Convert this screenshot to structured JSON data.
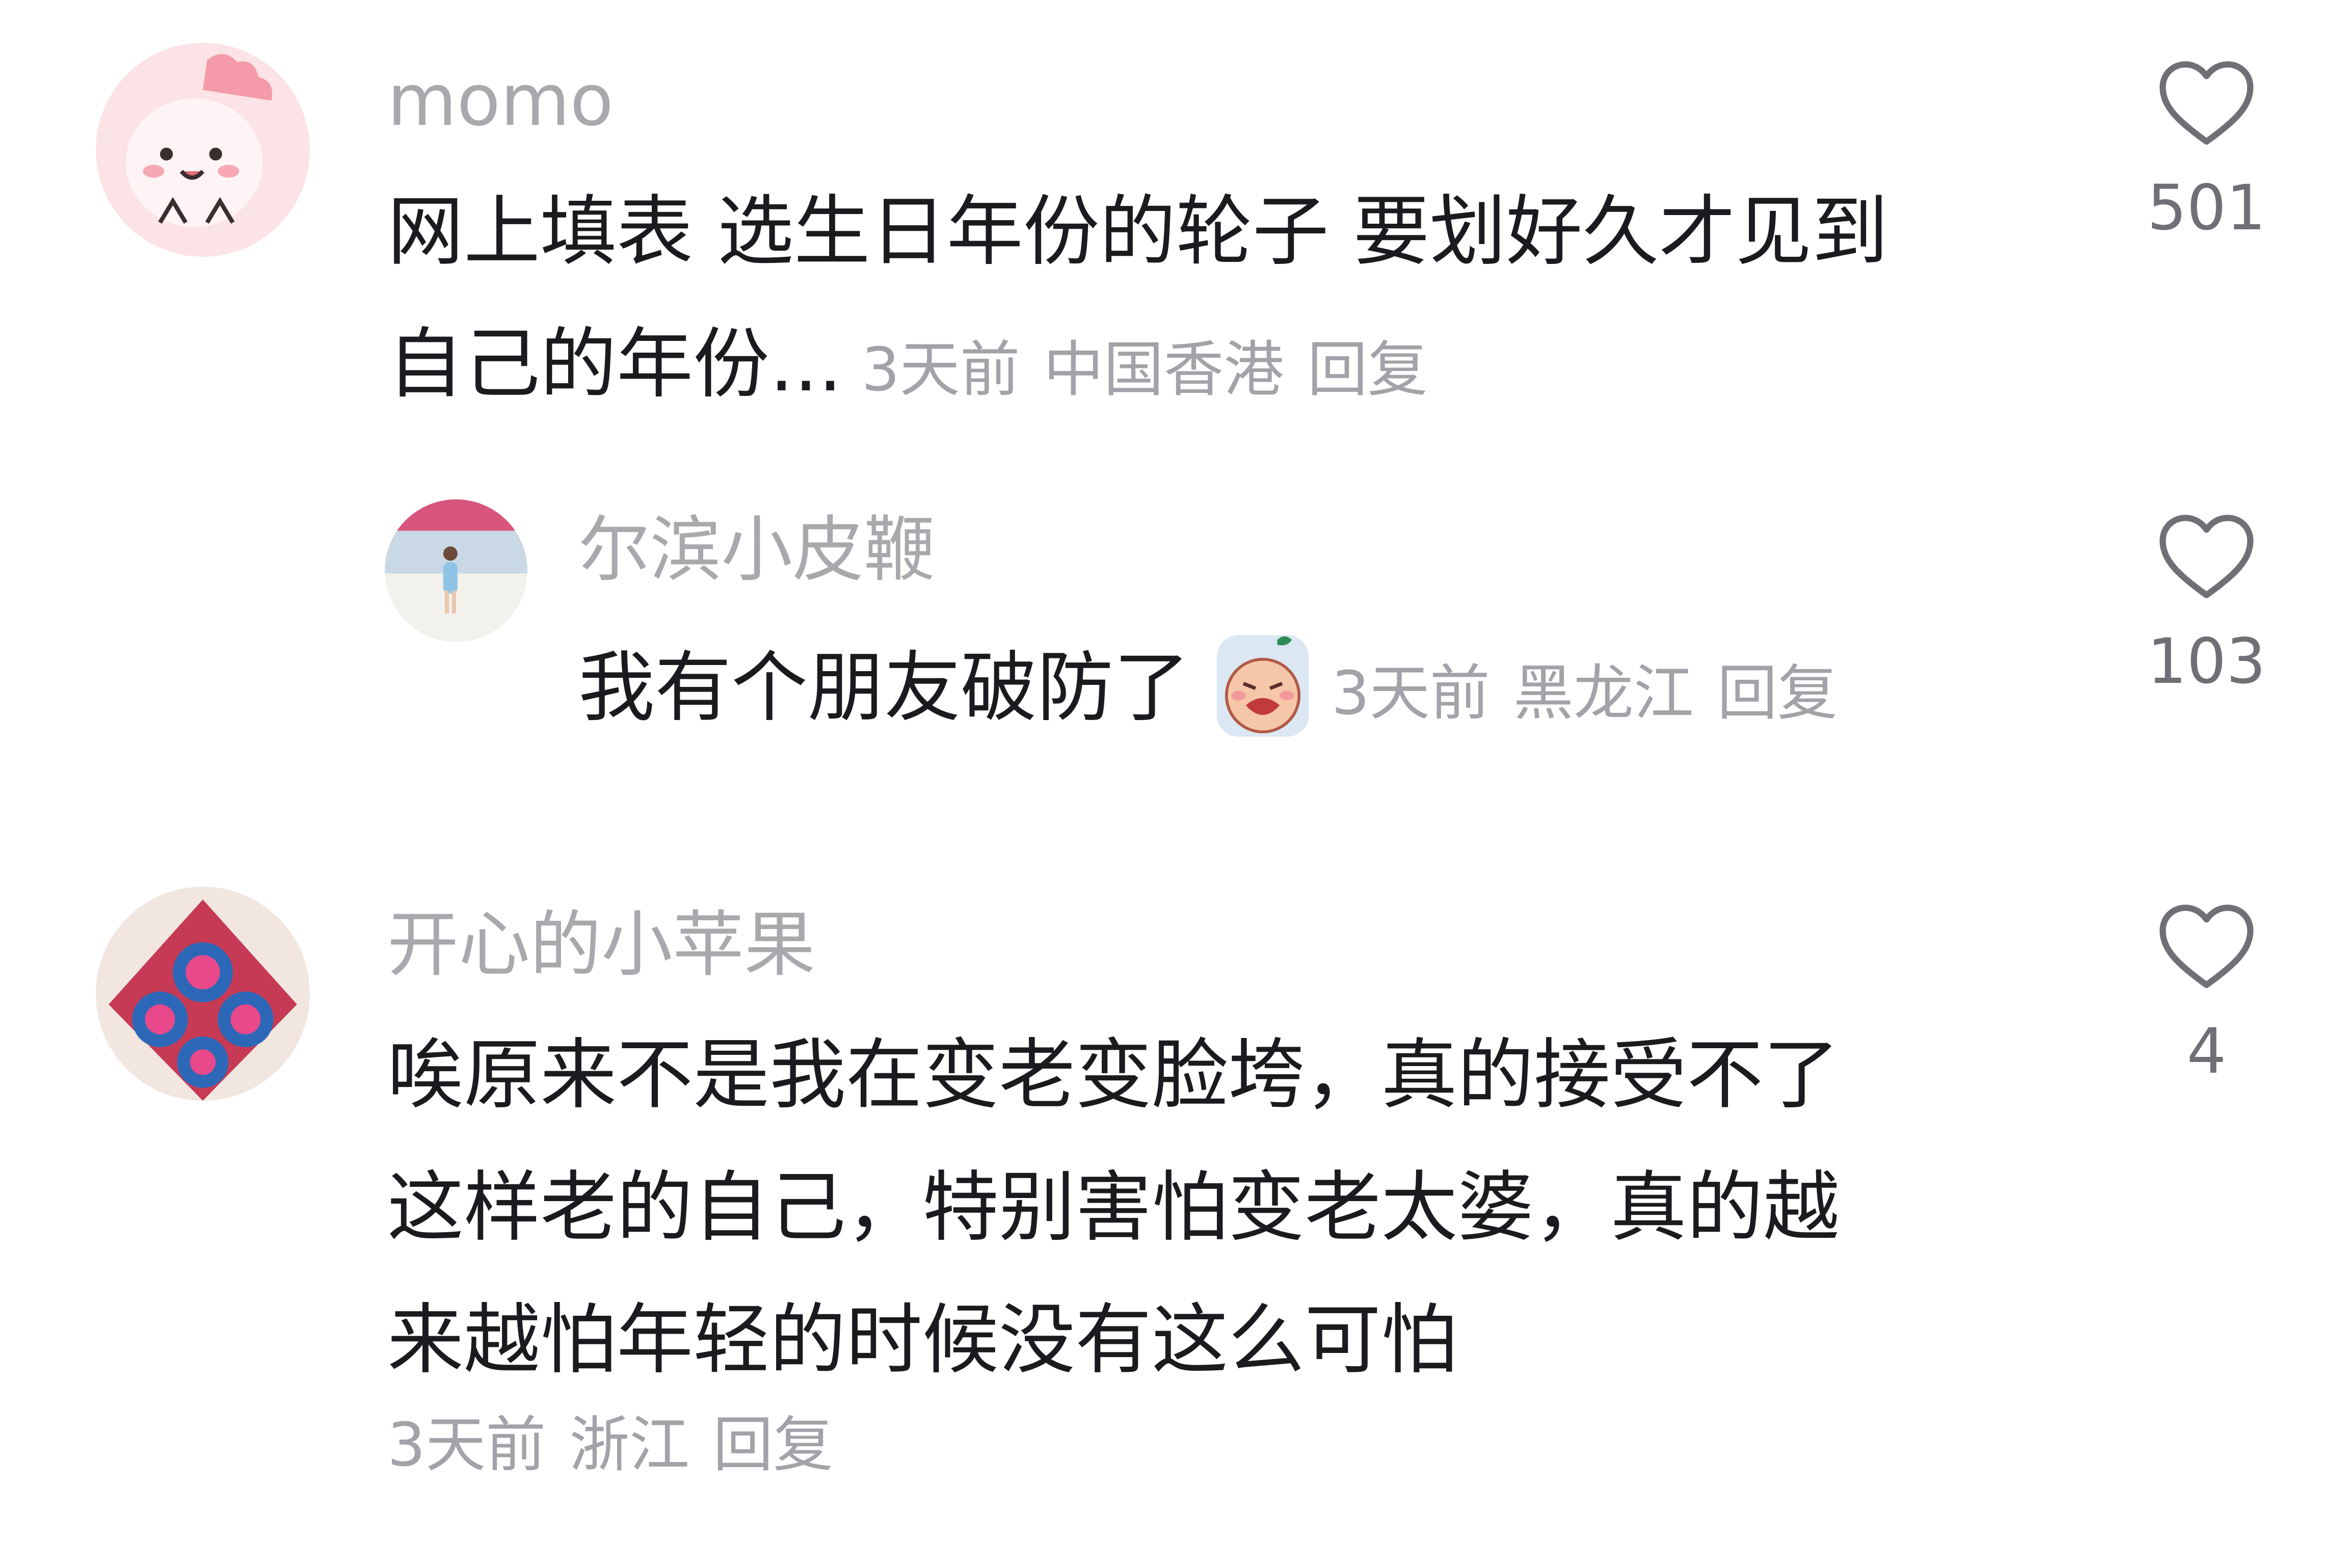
{
  "comments": [
    {
      "username": "momo",
      "text_lines": [
        "网上填表 选生日年份的轮子 要划好久才见到",
        "自己的年份..."
      ],
      "time": "3天前",
      "location": "中国香港",
      "reply_label": "回复",
      "likes": "501",
      "avatar_icon": "pink-cartoon-dinosaur-avatar"
    },
    {
      "username": "尔滨小皮鞭",
      "text": "我有个朋友破防了",
      "emoji_icon": "crying-face-emoji",
      "time": "3天前",
      "location": "黑龙江",
      "reply_label": "回复",
      "likes": "103",
      "avatar_icon": "beach-photo-avatar"
    },
    {
      "username": "开心的小苹果",
      "text_lines": [
        "唉原来不是我在变老变脸垮，真的接受不了",
        "这样老的自己，特别害怕变老太婆，真的越",
        "来越怕年轻的时候没有这么可怕"
      ],
      "time": "3天前",
      "location": "浙江",
      "reply_label": "回复",
      "likes": "4",
      "avatar_icon": "colorful-decoration-avatar"
    }
  ],
  "colors": {
    "username": "#a9a9ad",
    "body": "#1b1b1f",
    "meta": "#a2a2a8",
    "like_icon": "#6f6f75"
  }
}
